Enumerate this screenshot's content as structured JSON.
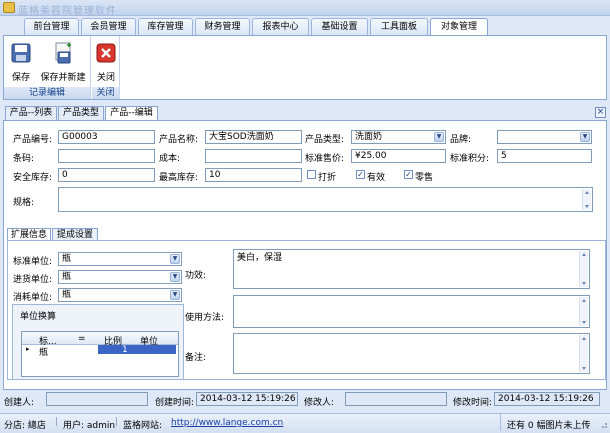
{
  "window": {
    "title": "蓝格美容院管理软件"
  },
  "menu_tabs": [
    "前台管理",
    "会员管理",
    "库存管理",
    "财务管理",
    "报表中心",
    "基础设置",
    "工具面板",
    "对象管理"
  ],
  "ribbon": {
    "save": "保存",
    "save_new": "保存并新建",
    "close": "关闭",
    "group_edit": "记录编辑",
    "group_close": "关闭"
  },
  "doc_tabs": [
    "产品--列表",
    "产品类型",
    "产品--编辑"
  ],
  "form": {
    "code_label": "产品编号:",
    "code": "G00003",
    "name_label": "产品名称:",
    "name": "大宝SOD洗面奶",
    "type_label": "产品类型:",
    "type": "洗面奶",
    "brand_label": "品牌:",
    "brand": "",
    "barcode_label": "条码:",
    "barcode": "",
    "cost_label": "成本:",
    "cost": "",
    "price_label": "标准售价:",
    "price": "¥25.00",
    "points_label": "标准积分:",
    "points": "5",
    "minstock_label": "安全库存:",
    "minstock": "0",
    "maxstock_label": "最高库存:",
    "maxstock": "10",
    "discount_label": "打折",
    "valid_label": "有效",
    "retail_label": "零售",
    "spec_label": "规格:",
    "spec": ""
  },
  "sub_tabs": [
    "扩展信息",
    "提成设置"
  ],
  "ext": {
    "std_unit_label": "标准单位:",
    "std_unit": "瓶",
    "in_unit_label": "进货单位:",
    "in_unit": "瓶",
    "use_unit_label": "消耗单位:",
    "use_unit": "瓶",
    "unit_conv_label": "单位换算",
    "grid_cols": [
      "标...",
      "=",
      "比例",
      "单位"
    ],
    "grid_row": [
      "瓶",
      "",
      "1",
      ""
    ],
    "effect_label": "功效:",
    "effect": "美白，保湿",
    "usage_label": "使用方法:",
    "usage": "",
    "note_label": "备注:",
    "note": ""
  },
  "footer": {
    "creator_label": "创建人:",
    "creator": "",
    "ctime_label": "创建时间:",
    "ctime": "2014-03-12 15:19:26",
    "modifier_label": "修改人:",
    "modifier": "",
    "mtime_label": "修改时间:",
    "mtime": "2014-03-12 15:19:26"
  },
  "status": {
    "store": "分店: 總店",
    "user": "用户: admin",
    "site_label": "蓝格网站:",
    "site": "http://www.lange.com.cn",
    "upload": "还有 0 幅图片未上传"
  }
}
